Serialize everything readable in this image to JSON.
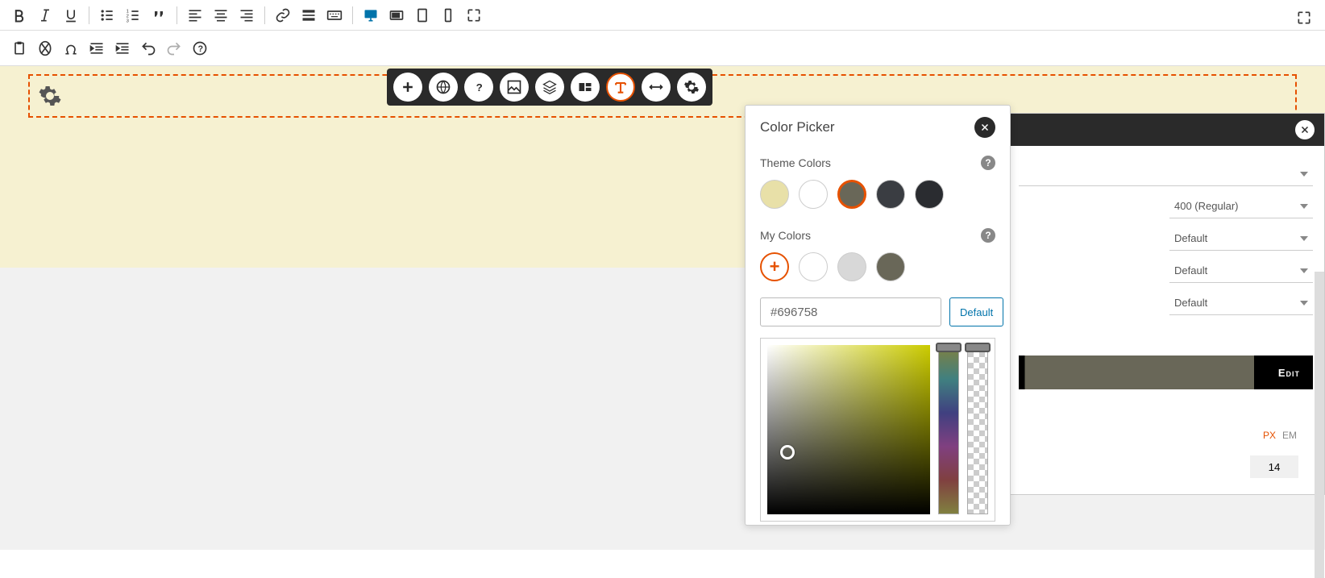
{
  "toolbar": {
    "row1": [
      "bold",
      "italic",
      "underline",
      "bullet-list",
      "numbered-list",
      "blockquote",
      "align-left",
      "align-center",
      "align-right",
      "link",
      "insert-more",
      "keyboard",
      "desktop",
      "tablet-landscape",
      "tablet",
      "phone",
      "fullscreen"
    ],
    "row2": [
      "paste",
      "clear-format",
      "special-char",
      "outdent",
      "indent",
      "undo",
      "redo",
      "help"
    ]
  },
  "colorPicker": {
    "title": "Color Picker",
    "themeColorsLabel": "Theme Colors",
    "themeColors": [
      "#e8e0a8",
      "#ffffff",
      "#696758",
      "#3a3d42",
      "#2a2c30"
    ],
    "themeSelectedIndex": 2,
    "myColorsLabel": "My Colors",
    "myColors": [
      "#ffffff",
      "#d8d8d8",
      "#696758"
    ],
    "hexValue": "#696758",
    "defaultButton": "Default"
  },
  "rightPanel": {
    "fontWeight": "400 (Regular)",
    "option1": "Default",
    "option2": "Default",
    "option3": "Default",
    "editLabel": "Edit",
    "unitPx": "PX",
    "unitEm": "EM",
    "sizeValue": "14"
  }
}
